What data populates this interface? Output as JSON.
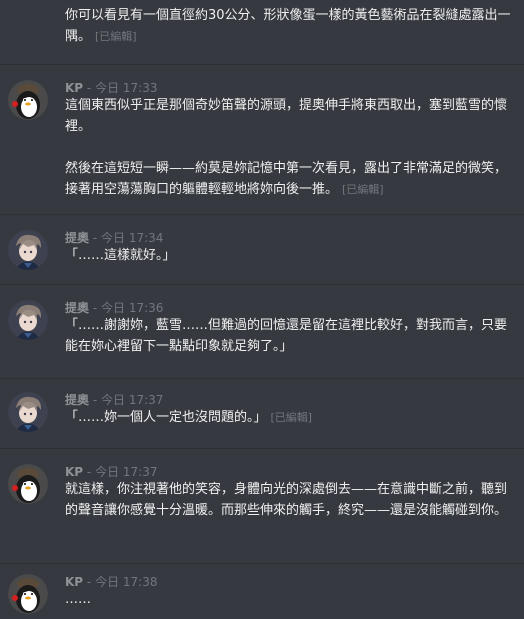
{
  "messages": [
    {
      "author": "",
      "timestamp": "",
      "paragraphs": [
        "你可以看見有一個直徑約30公分、形狀像蛋一樣的黃色藝術品在裂縫處露出一隅。"
      ],
      "edited": "[已編輯]"
    },
    {
      "author": "KP",
      "separator": "-",
      "timestamp": "今日 17:33",
      "paragraphs": [
        "這個東西似乎正是那個奇妙笛聲的源頭，提奧伸手將東西取出，塞到藍雪的懷裡。",
        "然後在這短短一瞬——約莫是妳記憶中第一次看見，露出了非常滿足的微笑，接著用空蕩蕩胸口的軀體輕輕地將妳向後一推。"
      ],
      "edited": "[已編輯]"
    },
    {
      "author": "提奧",
      "separator": "-",
      "timestamp": "今日 17:34",
      "paragraphs": [
        "「……這樣就好。」"
      ],
      "edited": ""
    },
    {
      "author": "提奧",
      "separator": "-",
      "timestamp": "今日 17:36",
      "paragraphs": [
        "「……謝謝妳，藍雪……但難過的回憶還是留在這裡比較好，對我而言，只要能在妳心裡留下一點點印象就足夠了。」"
      ],
      "edited": ""
    },
    {
      "author": "提奧",
      "separator": "-",
      "timestamp": "今日 17:37",
      "paragraphs": [
        "「……妳一個人一定也沒問題的。」"
      ],
      "edited": "[已編輯]"
    },
    {
      "author": "KP",
      "separator": "-",
      "timestamp": "今日 17:37",
      "paragraphs": [
        "就這樣，你注視著他的笑容，身體向光的深處倒去——在意識中斷之前，聽到的聲音讓你感覺十分溫暖。而那些伸來的觸手，終究——還是沒能觸碰到你。"
      ],
      "edited": ""
    },
    {
      "author": "KP",
      "separator": "-",
      "timestamp": "今日 17:38",
      "paragraphs": [
        "……"
      ],
      "edited": ""
    }
  ],
  "colors": {
    "background": "#36393f",
    "divider": "#2e3035",
    "author": "#8e9297",
    "timestamp": "#72767d",
    "text": "#f0f0f0",
    "edited": "#72767d"
  },
  "icons": {
    "kp_avatar": "penguin-avatar-icon",
    "theo_avatar": "theo-character-avatar-icon"
  }
}
